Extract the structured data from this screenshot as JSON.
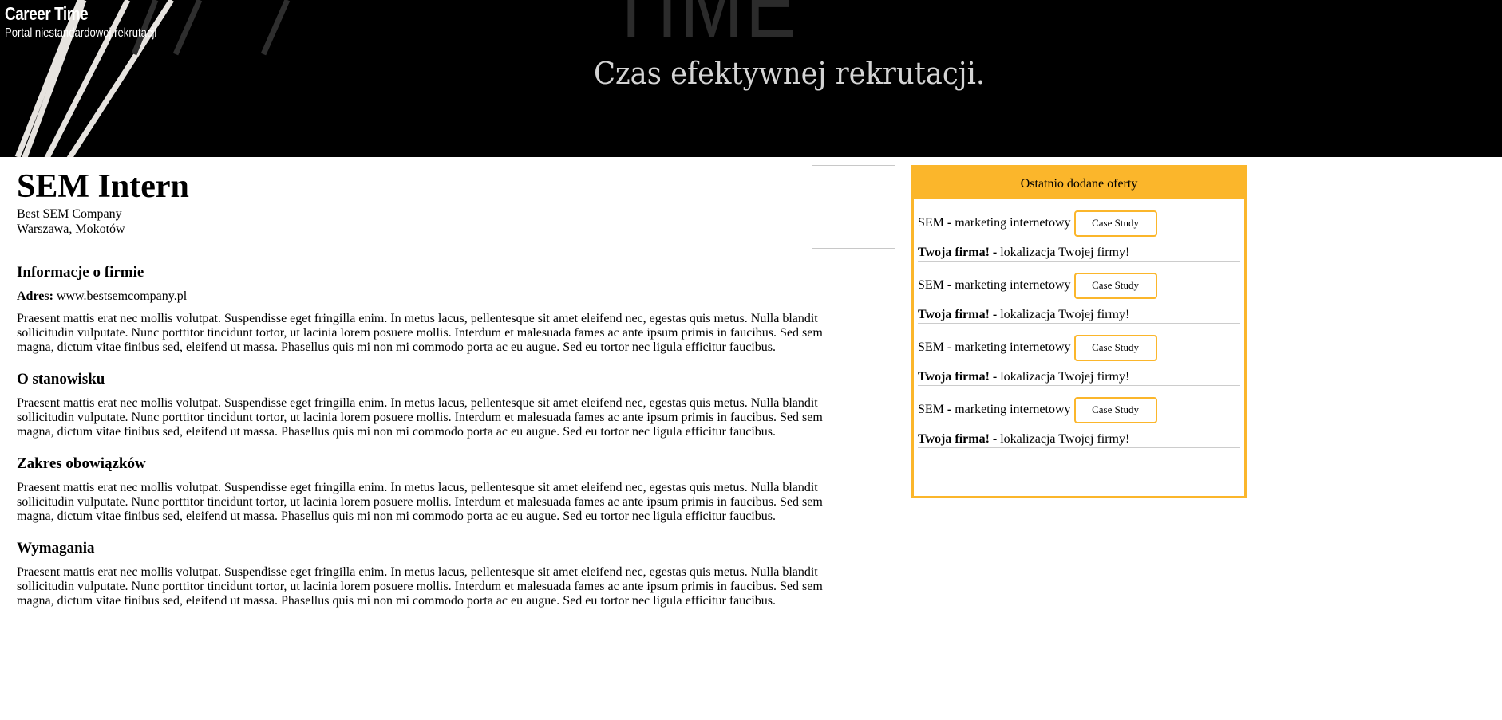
{
  "header": {
    "title": "Career Time",
    "subtitle": "Portal niestandardowej rekrutacji",
    "banner_big_text": "TIME",
    "banner_tagline": "Czas efektywnej rekrutacji."
  },
  "job": {
    "title": "SEM Intern",
    "company": "Best SEM Company",
    "location": "Warszawa, Mokotów",
    "sections": [
      {
        "heading": "Informacje o firmie",
        "address_label": "Adres:",
        "address_value": "www.bestsemcompany.pl",
        "text": "Praesent mattis erat nec mollis volutpat. Suspendisse eget fringilla enim. In metus lacus, pellentesque sit amet eleifend nec, egestas quis metus. Nulla blandit sollicitudin vulputate. Nunc porttitor tincidunt tortor, ut lacinia lorem posuere mollis. Interdum et malesuada fames ac ante ipsum primis in faucibus. Sed sem magna, dictum vitae finibus sed, eleifend ut massa. Phasellus quis mi non mi commodo porta ac eu augue. Sed eu tortor nec ligula efficitur faucibus."
      },
      {
        "heading": "O stanowisku",
        "text": "Praesent mattis erat nec mollis volutpat. Suspendisse eget fringilla enim. In metus lacus, pellentesque sit amet eleifend nec, egestas quis metus. Nulla blandit sollicitudin vulputate. Nunc porttitor tincidunt tortor, ut lacinia lorem posuere mollis. Interdum et malesuada fames ac ante ipsum primis in faucibus. Sed sem magna, dictum vitae finibus sed, eleifend ut massa. Phasellus quis mi non mi commodo porta ac eu augue. Sed eu tortor nec ligula efficitur faucibus."
      },
      {
        "heading": "Zakres obowiązków",
        "text": "Praesent mattis erat nec mollis volutpat. Suspendisse eget fringilla enim. In metus lacus, pellentesque sit amet eleifend nec, egestas quis metus. Nulla blandit sollicitudin vulputate. Nunc porttitor tincidunt tortor, ut lacinia lorem posuere mollis. Interdum et malesuada fames ac ante ipsum primis in faucibus. Sed sem magna, dictum vitae finibus sed, eleifend ut massa. Phasellus quis mi non mi commodo porta ac eu augue. Sed eu tortor nec ligula efficitur faucibus."
      },
      {
        "heading": "Wymagania",
        "text": "Praesent mattis erat nec mollis volutpat. Suspendisse eget fringilla enim. In metus lacus, pellentesque sit amet eleifend nec, egestas quis metus. Nulla blandit sollicitudin vulputate. Nunc porttitor tincidunt tortor, ut lacinia lorem posuere mollis. Interdum et malesuada fames ac ante ipsum primis in faucibus. Sed sem magna, dictum vitae finibus sed, eleifend ut massa. Phasellus quis mi non mi commodo porta ac eu augue. Sed eu tortor nec ligula efficitur faucibus."
      }
    ]
  },
  "sidebar": {
    "title": "Ostatnio dodane oferty",
    "accent": "#fbb62b",
    "offers": [
      {
        "title_a": "SEM",
        "sep": "-",
        "title_b": "marketing internetowy",
        "button": "Case Study",
        "company": "Twoja firma!",
        "sep2": "-",
        "location": "lokalizacja Twojej firmy!"
      },
      {
        "title_a": "SEM",
        "sep": "-",
        "title_b": "marketing internetowy",
        "button": "Case Study",
        "company": "Twoja firma!",
        "sep2": "-",
        "location": "lokalizacja Twojej firmy!"
      },
      {
        "title_a": "SEM",
        "sep": "-",
        "title_b": "marketing internetowy",
        "button": "Case Study",
        "company": "Twoja firma!",
        "sep2": "-",
        "location": "lokalizacja Twojej firmy!"
      },
      {
        "title_a": "SEM",
        "sep": "-",
        "title_b": "marketing internetowy",
        "button": "Case Study",
        "company": "Twoja firma!",
        "sep2": "-",
        "location": "lokalizacja Twojej firmy!"
      }
    ]
  }
}
